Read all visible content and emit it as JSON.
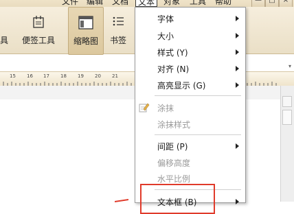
{
  "menubar": {
    "items": [
      {
        "label": "文件"
      },
      {
        "label": "编辑"
      },
      {
        "label": "文档"
      },
      {
        "label": "文本"
      },
      {
        "label": "对象"
      },
      {
        "label": "工具"
      },
      {
        "label": "帮助"
      }
    ],
    "window_buttons": [
      "—",
      "□",
      "×"
    ]
  },
  "toolbar": {
    "items": [
      {
        "label": "具",
        "icon": "tool-icon"
      },
      {
        "label": "便签工具",
        "icon": "note-icon"
      },
      {
        "label": "缩略图",
        "icon": "thumbnail-icon"
      },
      {
        "label": "书签",
        "icon": "bookmark-icon"
      }
    ]
  },
  "ruler": {
    "numbers": [
      "15",
      "16",
      "17",
      "18",
      "19",
      "20",
      "21"
    ]
  },
  "text_menu": {
    "items": [
      {
        "label": "字体",
        "submenu": true
      },
      {
        "label": "大小",
        "submenu": true
      },
      {
        "label": "样式 (Y)",
        "submenu": true
      },
      {
        "label": "对齐 (N)",
        "submenu": true
      },
      {
        "label": "高亮显示 (G)",
        "submenu": true
      },
      {
        "label": "涂抹",
        "disabled": true,
        "icon": "smudge-icon"
      },
      {
        "label": "涂抹样式",
        "disabled": true
      },
      {
        "label": "间距 (P)",
        "submenu": true
      },
      {
        "label": "偏移高度",
        "disabled": true
      },
      {
        "label": "水平比例",
        "disabled": true
      },
      {
        "label": "文本框 (B)",
        "submenu": true
      }
    ]
  },
  "colors": {
    "annotation_red": "#e03a2a",
    "toolbar_bg": "#efe3c8"
  }
}
